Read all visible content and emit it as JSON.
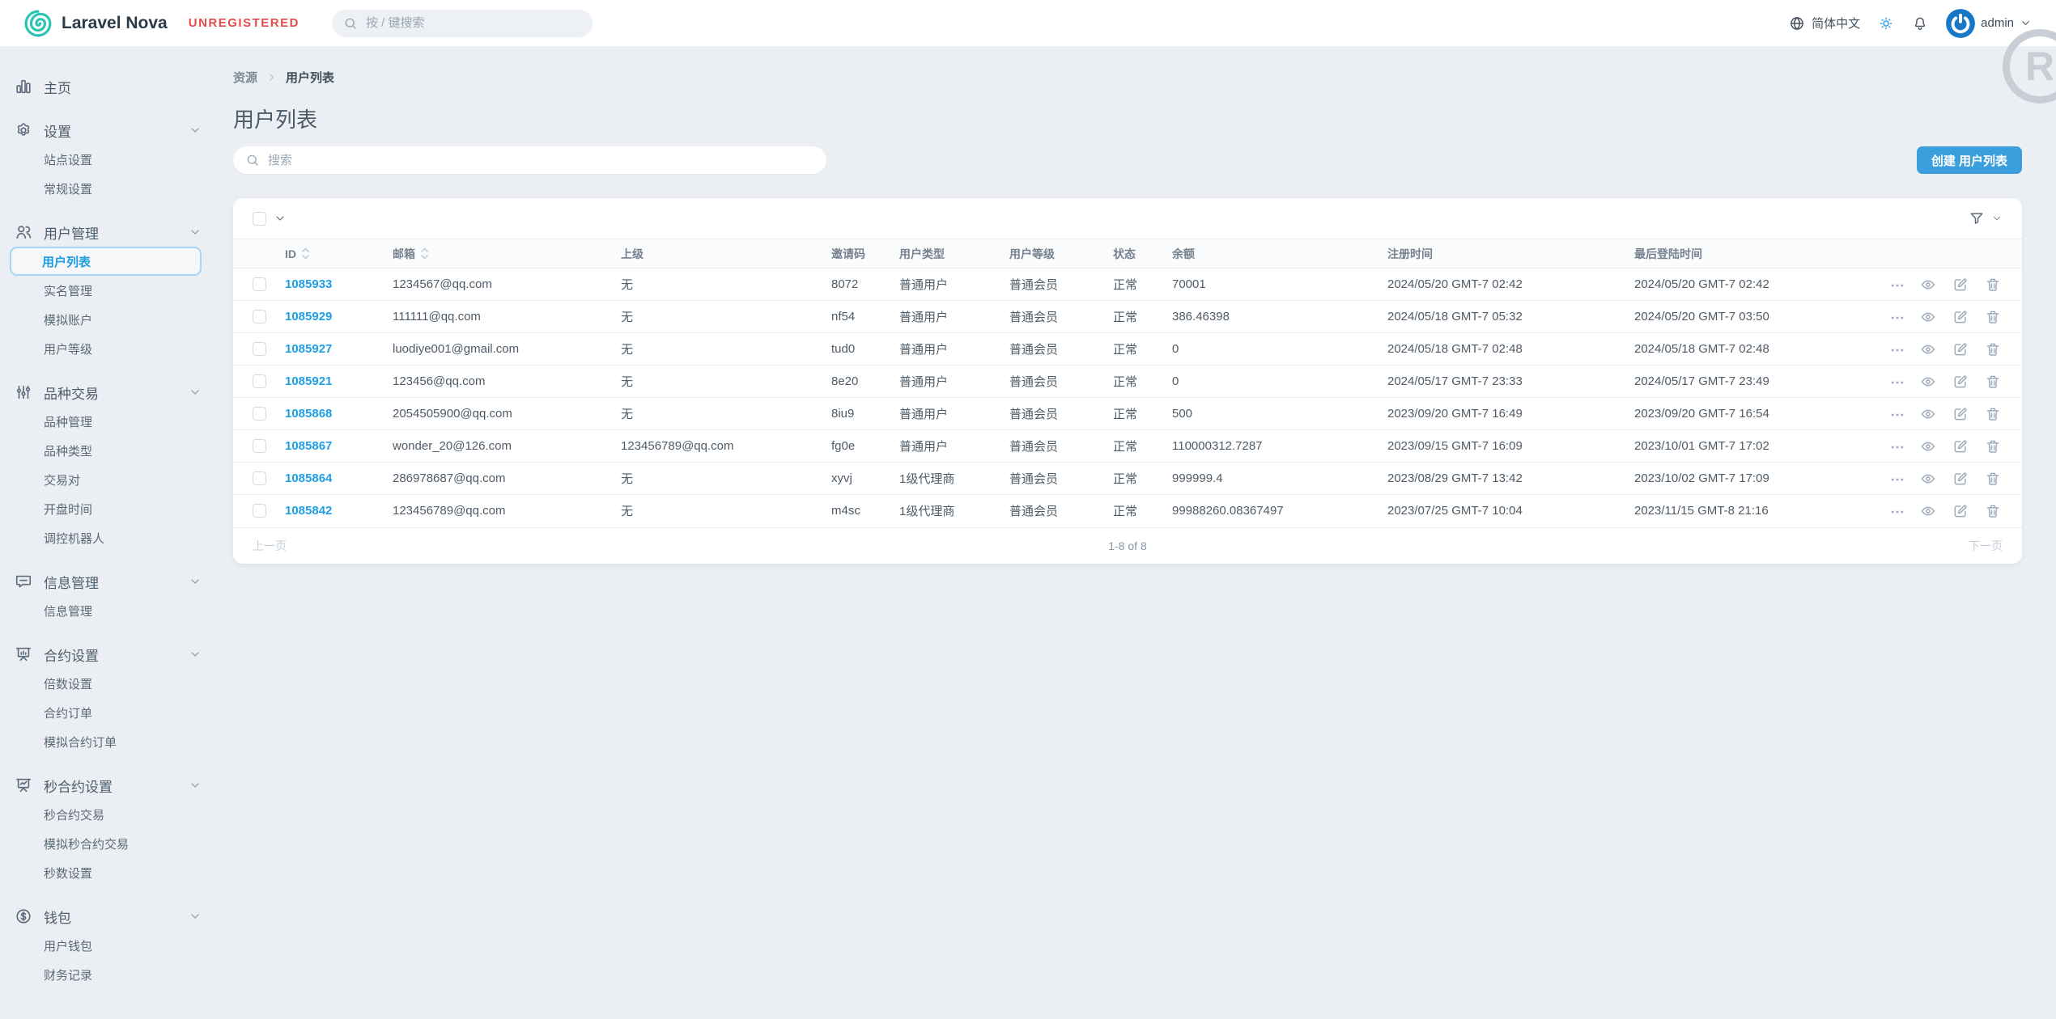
{
  "navbar": {
    "brand": "Laravel Nova",
    "license_badge": "UNREGISTERED",
    "search_placeholder": "按 / 键搜索",
    "language": "简体中文",
    "username": "admin",
    "watermark_letter": "R"
  },
  "sidebar": {
    "items": [
      {
        "type": "top",
        "icon": "chart-bar-icon",
        "label": "主页",
        "chevron": false
      },
      {
        "type": "top",
        "icon": "gear-icon",
        "label": "设置",
        "chevron": true
      },
      {
        "type": "child",
        "label": "站点设置"
      },
      {
        "type": "child",
        "label": "常规设置"
      },
      {
        "type": "top",
        "icon": "users-icon",
        "label": "用户管理",
        "chevron": true
      },
      {
        "type": "child",
        "label": "用户列表",
        "active": true
      },
      {
        "type": "child",
        "label": "实名管理"
      },
      {
        "type": "child",
        "label": "模拟账户"
      },
      {
        "type": "child",
        "label": "用户等级"
      },
      {
        "type": "top",
        "icon": "sliders-icon",
        "label": "品种交易",
        "chevron": true
      },
      {
        "type": "child",
        "label": "品种管理"
      },
      {
        "type": "child",
        "label": "品种类型"
      },
      {
        "type": "child",
        "label": "交易对"
      },
      {
        "type": "child",
        "label": "开盘时间"
      },
      {
        "type": "child",
        "label": "调控机器人"
      },
      {
        "type": "top",
        "icon": "message-icon",
        "label": "信息管理",
        "chevron": true
      },
      {
        "type": "child",
        "label": "信息管理"
      },
      {
        "type": "top",
        "icon": "presentation-bar-icon",
        "label": "合约设置",
        "chevron": true
      },
      {
        "type": "child",
        "label": "倍数设置"
      },
      {
        "type": "child",
        "label": "合约订单"
      },
      {
        "type": "child",
        "label": "模拟合约订单"
      },
      {
        "type": "top",
        "icon": "presentation-line-icon",
        "label": "秒合约设置",
        "chevron": true
      },
      {
        "type": "child",
        "label": "秒合约交易"
      },
      {
        "type": "child",
        "label": "模拟秒合约交易"
      },
      {
        "type": "child",
        "label": "秒数设置"
      },
      {
        "type": "top",
        "icon": "currency-dollar-icon",
        "label": "钱包",
        "chevron": true
      },
      {
        "type": "child",
        "label": "用户钱包"
      },
      {
        "type": "child",
        "label": "财务记录"
      }
    ]
  },
  "main": {
    "breadcrumb": {
      "parent": "资源",
      "current": "用户列表"
    },
    "title": "用户列表",
    "search_placeholder": "搜索",
    "create_button": "创建 用户列表"
  },
  "table": {
    "columns": [
      {
        "label": "ID",
        "sortable": true
      },
      {
        "label": "邮箱",
        "sortable": true
      },
      {
        "label": "上级",
        "sortable": false
      },
      {
        "label": "邀请码",
        "sortable": false
      },
      {
        "label": "用户类型",
        "sortable": false
      },
      {
        "label": "用户等级",
        "sortable": false
      },
      {
        "label": "状态",
        "sortable": false
      },
      {
        "label": "余额",
        "sortable": false
      },
      {
        "label": "注册时间",
        "sortable": false
      },
      {
        "label": "最后登陆时间",
        "sortable": false
      }
    ],
    "rows": [
      {
        "id": "1085933",
        "email": "1234567@qq.com",
        "parent": "无",
        "invite_code": "8072",
        "user_type": "普通用户",
        "user_level": "普通会员",
        "status": "正常",
        "balance": "70001",
        "registered_at": "2024/05/20 GMT-7 02:42",
        "last_login_at": "2024/05/20 GMT-7 02:42"
      },
      {
        "id": "1085929",
        "email": "111111@qq.com",
        "parent": "无",
        "invite_code": "nf54",
        "user_type": "普通用户",
        "user_level": "普通会员",
        "status": "正常",
        "balance": "386.46398",
        "registered_at": "2024/05/18 GMT-7 05:32",
        "last_login_at": "2024/05/20 GMT-7 03:50"
      },
      {
        "id": "1085927",
        "email": "luodiye001@gmail.com",
        "parent": "无",
        "invite_code": "tud0",
        "user_type": "普通用户",
        "user_level": "普通会员",
        "status": "正常",
        "balance": "0",
        "registered_at": "2024/05/18 GMT-7 02:48",
        "last_login_at": "2024/05/18 GMT-7 02:48"
      },
      {
        "id": "1085921",
        "email": "123456@qq.com",
        "parent": "无",
        "invite_code": "8e20",
        "user_type": "普通用户",
        "user_level": "普通会员",
        "status": "正常",
        "balance": "0",
        "registered_at": "2024/05/17 GMT-7 23:33",
        "last_login_at": "2024/05/17 GMT-7 23:49"
      },
      {
        "id": "1085868",
        "email": "2054505900@qq.com",
        "parent": "无",
        "invite_code": "8iu9",
        "user_type": "普通用户",
        "user_level": "普通会员",
        "status": "正常",
        "balance": "500",
        "registered_at": "2023/09/20 GMT-7 16:49",
        "last_login_at": "2023/09/20 GMT-7 16:54"
      },
      {
        "id": "1085867",
        "email": "wonder_20@126.com",
        "parent": "123456789@qq.com",
        "invite_code": "fg0e",
        "user_type": "普通用户",
        "user_level": "普通会员",
        "status": "正常",
        "balance": "110000312.7287",
        "registered_at": "2023/09/15 GMT-7 16:09",
        "last_login_at": "2023/10/01 GMT-7 17:02"
      },
      {
        "id": "1085864",
        "email": "286978687@qq.com",
        "parent": "无",
        "invite_code": "xyvj",
        "user_type": "1级代理商",
        "user_level": "普通会员",
        "status": "正常",
        "balance": "999999.4",
        "registered_at": "2023/08/29 GMT-7 13:42",
        "last_login_at": "2023/10/02 GMT-7 17:09"
      },
      {
        "id": "1085842",
        "email": "123456789@qq.com",
        "parent": "无",
        "invite_code": "m4sc",
        "user_type": "1级代理商",
        "user_level": "普通会员",
        "status": "正常",
        "balance": "99988260.08367497",
        "registered_at": "2023/07/25 GMT-7 10:04",
        "last_login_at": "2023/11/15 GMT-8 21:16"
      }
    ],
    "pagination": {
      "prev": "上一页",
      "info": "1-8 of 8",
      "next": "下一页"
    }
  },
  "colors": {
    "accent_blue": "#3b9edd",
    "link_blue": "#1f9fe5",
    "logo_teal": "#2cc4b2",
    "badge_red": "#e64c4c",
    "active_border": "#a2d7f5",
    "background": "#ebeff3"
  }
}
